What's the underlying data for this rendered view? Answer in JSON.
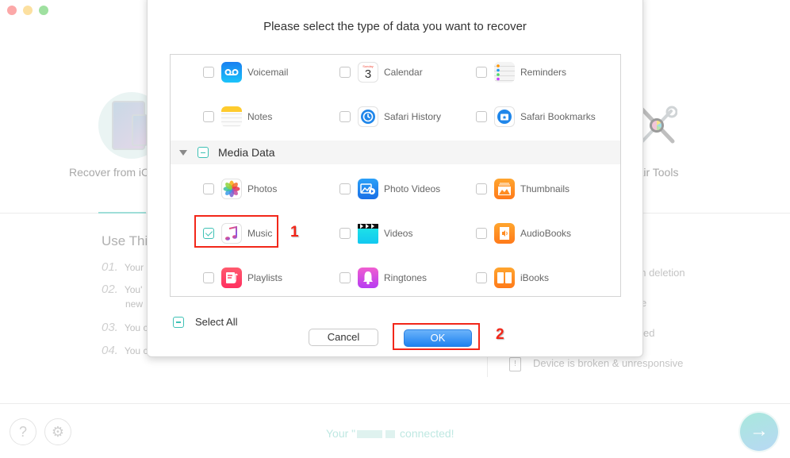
{
  "window": {
    "traffic_lights": [
      "close",
      "minimize",
      "zoom"
    ]
  },
  "background": {
    "mode_left_label": "Recover from iC",
    "mode_right_label": "epair Tools",
    "use_title": "Use Thi",
    "steps": [
      {
        "num": "01.",
        "text": "Your"
      },
      {
        "num": "02.",
        "text": "You'",
        "text2": "new"
      },
      {
        "num": "03.",
        "text": "You c"
      },
      {
        "num": "04.",
        "text": "You c"
      }
    ],
    "right_items": [
      "en deletion",
      "e",
      "ed",
      "Device is broken & unresponsive"
    ],
    "status": {
      "prefix": "Your \"",
      "suffix": "connected!"
    },
    "help_icon": "?",
    "settings_icon": "⚙",
    "next_icon": "→"
  },
  "dialog": {
    "title": "Please select the type of data you want to recover",
    "rows_top": [
      [
        {
          "label": "Voicemail",
          "icon": "voicemail-icon",
          "checked": false
        },
        {
          "label": "Calendar",
          "icon": "calendar-icon",
          "checked": false,
          "icon_text": "3",
          "icon_day": "Sunday"
        },
        {
          "label": "Reminders",
          "icon": "reminders-icon",
          "checked": false
        }
      ],
      [
        {
          "label": "Notes",
          "icon": "notes-icon",
          "checked": false
        },
        {
          "label": "Safari History",
          "icon": "safari-history-icon",
          "checked": false
        },
        {
          "label": "Safari Bookmarks",
          "icon": "safari-bookmarks-icon",
          "checked": false
        }
      ]
    ],
    "group": {
      "label": "Media Data",
      "state": "mixed"
    },
    "rows_media": [
      [
        {
          "label": "Photos",
          "icon": "photos-icon",
          "checked": false
        },
        {
          "label": "Photo Videos",
          "icon": "photo-videos-icon",
          "checked": false
        },
        {
          "label": "Thumbnails",
          "icon": "thumbnails-icon",
          "checked": false
        }
      ],
      [
        {
          "label": "Music",
          "icon": "music-icon",
          "checked": true
        },
        {
          "label": "Videos",
          "icon": "videos-icon",
          "checked": false
        },
        {
          "label": "AudioBooks",
          "icon": "audiobooks-icon",
          "checked": false
        }
      ],
      [
        {
          "label": "Playlists",
          "icon": "playlists-icon",
          "checked": false
        },
        {
          "label": "Ringtones",
          "icon": "ringtones-icon",
          "checked": false
        },
        {
          "label": "iBooks",
          "icon": "ibooks-icon",
          "checked": false
        }
      ]
    ],
    "select_all_label": "Select All",
    "select_all_state": "mixed",
    "cancel_label": "Cancel",
    "ok_label": "OK"
  },
  "annotations": {
    "step1": "1",
    "step2": "2",
    "color": "#f2271a"
  },
  "colors": {
    "accent_teal": "#3ec1b5",
    "ok_blue": "#1e82f0"
  }
}
